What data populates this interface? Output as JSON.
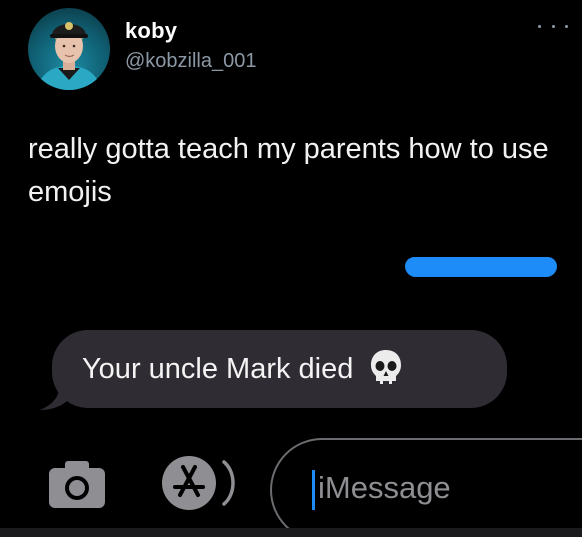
{
  "tweet": {
    "display_name": "koby",
    "handle": "@kobzilla_001",
    "text": "really gotta teach my parents how to use emojis",
    "more_icon": "ellipsis-icon"
  },
  "messages": {
    "received_text": "Your uncle Mark died",
    "received_emoji": "skull-emoji",
    "sent_bubble_color": "#1d8cf8",
    "received_bubble_color": "#2f2d33"
  },
  "input_bar": {
    "camera_icon": "camera-icon",
    "apps_icon": "app-store-icon",
    "placeholder": "iMessage"
  }
}
